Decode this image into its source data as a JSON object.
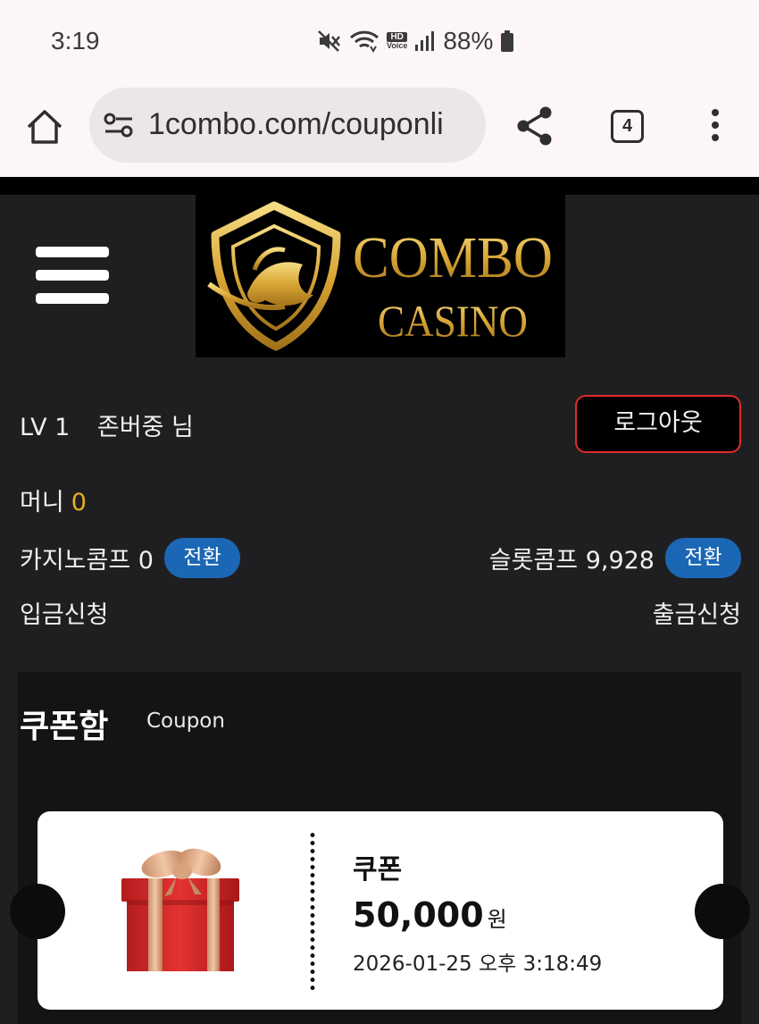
{
  "status_bar": {
    "time": "3:19",
    "hd": "HD",
    "voice": "Voice",
    "battery": "88%"
  },
  "browser": {
    "url": "1combo.com/couponli",
    "tab_count": "4"
  },
  "logo": {
    "line1": "COMBO",
    "line2": "CASINO"
  },
  "user": {
    "level": "LV 1",
    "name": "존버중 님",
    "logout_label": "로그아웃",
    "money_label": "머니",
    "money_value": "0",
    "casino_comp_label": "카지노콤프 0",
    "slot_comp_label": "슬롯콤프 9,928",
    "convert_label": "전환",
    "deposit_label": "입금신청",
    "withdraw_label": "출금신청"
  },
  "coupon_section": {
    "title": "쿠폰함",
    "subtitle": "Coupon",
    "coupon": {
      "name": "쿠폰",
      "amount": "50,000",
      "unit": "원",
      "date": "2026-01-25 오후 3:18:49"
    }
  },
  "colors": {
    "accent_gold": "#e6b21c",
    "pill_blue": "#1b67b5",
    "logout_border": "#e02a2a",
    "page_bg": "#1f1f21"
  }
}
